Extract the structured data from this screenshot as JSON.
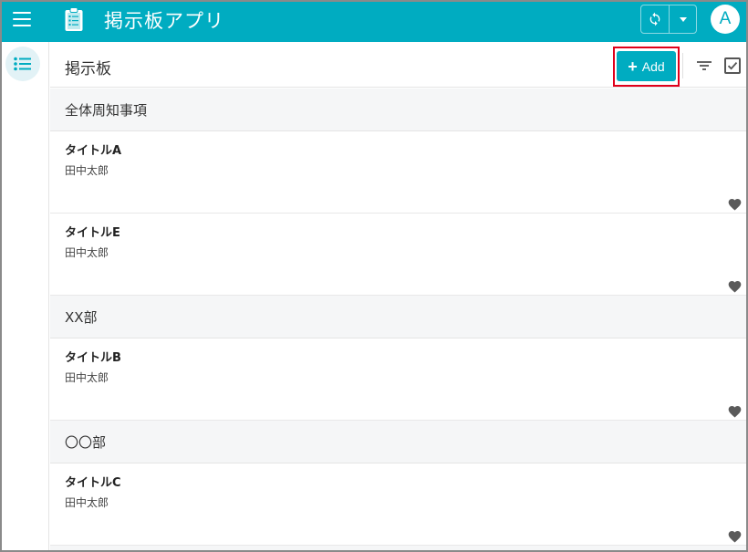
{
  "app": {
    "title": "掲示板アプリ",
    "avatar_letter": "A"
  },
  "toolbar": {
    "page_title": "掲示板",
    "add_label": "Add"
  },
  "colors": {
    "accent": "#00acc1",
    "highlight": "#e0001b",
    "heart": "#555555"
  },
  "sections": [
    {
      "name": "全体周知事項",
      "posts": [
        {
          "title": "タイトルA",
          "author": "田中太郎"
        },
        {
          "title": "タイトルE",
          "author": "田中太郎"
        }
      ]
    },
    {
      "name": "XX部",
      "posts": [
        {
          "title": "タイトルB",
          "author": "田中太郎"
        }
      ]
    },
    {
      "name": "〇〇部",
      "posts": [
        {
          "title": "タイトルC",
          "author": "田中太郎"
        }
      ]
    }
  ]
}
